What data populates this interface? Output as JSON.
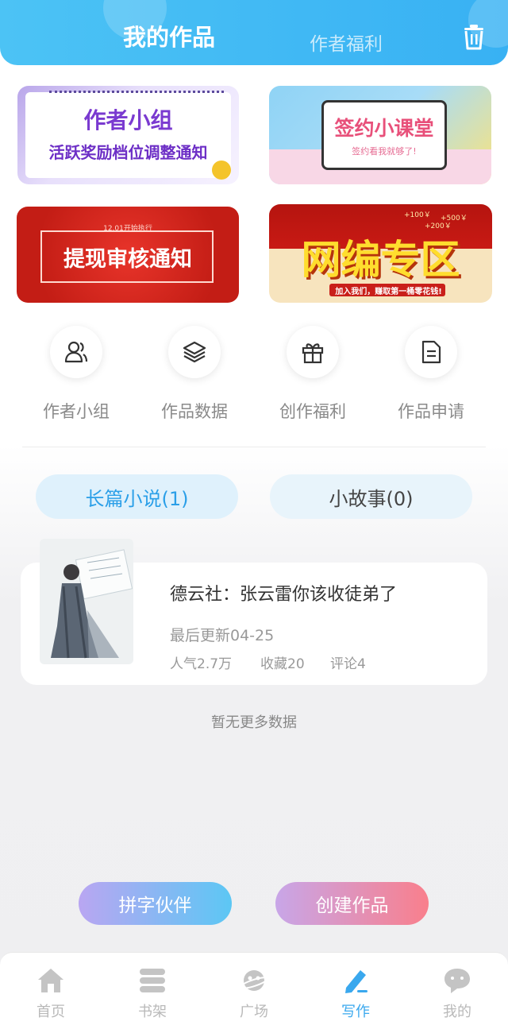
{
  "header": {
    "tab_my_works": "我的作品",
    "tab_author_benefits": "作者福利",
    "trash_icon": "trash-icon"
  },
  "banners": [
    {
      "name": "author-group-banner",
      "line1": "作者小组",
      "line2": "活跃奖励档位调整通知"
    },
    {
      "name": "sign-class-banner",
      "line1": "签约小课堂",
      "line2": "签约看我就够了!"
    },
    {
      "name": "withdraw-banner",
      "small": "12.01开始执行",
      "line1": "提现审核通知"
    },
    {
      "name": "web-editor-banner",
      "line1": "网编专区",
      "line2": "加入我们，赚取第一桶零花钱!",
      "prices": [
        "+100￥",
        "+500￥",
        "+200￥"
      ]
    }
  ],
  "quick_links": [
    {
      "label": "作者小组",
      "icon": "users-icon"
    },
    {
      "label": "作品数据",
      "icon": "layers-icon"
    },
    {
      "label": "创作福利",
      "icon": "gift-icon"
    },
    {
      "label": "作品申请",
      "icon": "document-icon"
    }
  ],
  "categories": [
    {
      "label": "长篇小说(1)",
      "active": true
    },
    {
      "label": "小故事(0)",
      "active": false
    }
  ],
  "work": {
    "title": "德云社：张云雷你该收徒弟了",
    "updated": "最后更新04-25",
    "popularity": "人气2.7万",
    "favorites": "收藏20",
    "comments": "评论4"
  },
  "empty_text": "暂无更多数据",
  "actions": {
    "partner": "拼字伙伴",
    "create": "创建作品"
  },
  "colors": {
    "accent": "#3aa8ee",
    "header_start": "#4cc3f5",
    "header_end": "#38b1f3"
  },
  "nav": [
    {
      "label": "首页",
      "icon": "home-icon",
      "active": false
    },
    {
      "label": "书架",
      "icon": "bookshelf-icon",
      "active": false
    },
    {
      "label": "广场",
      "icon": "planet-icon",
      "active": false
    },
    {
      "label": "写作",
      "icon": "pen-icon",
      "active": true
    },
    {
      "label": "我的",
      "icon": "chat-face-icon",
      "active": false
    }
  ]
}
